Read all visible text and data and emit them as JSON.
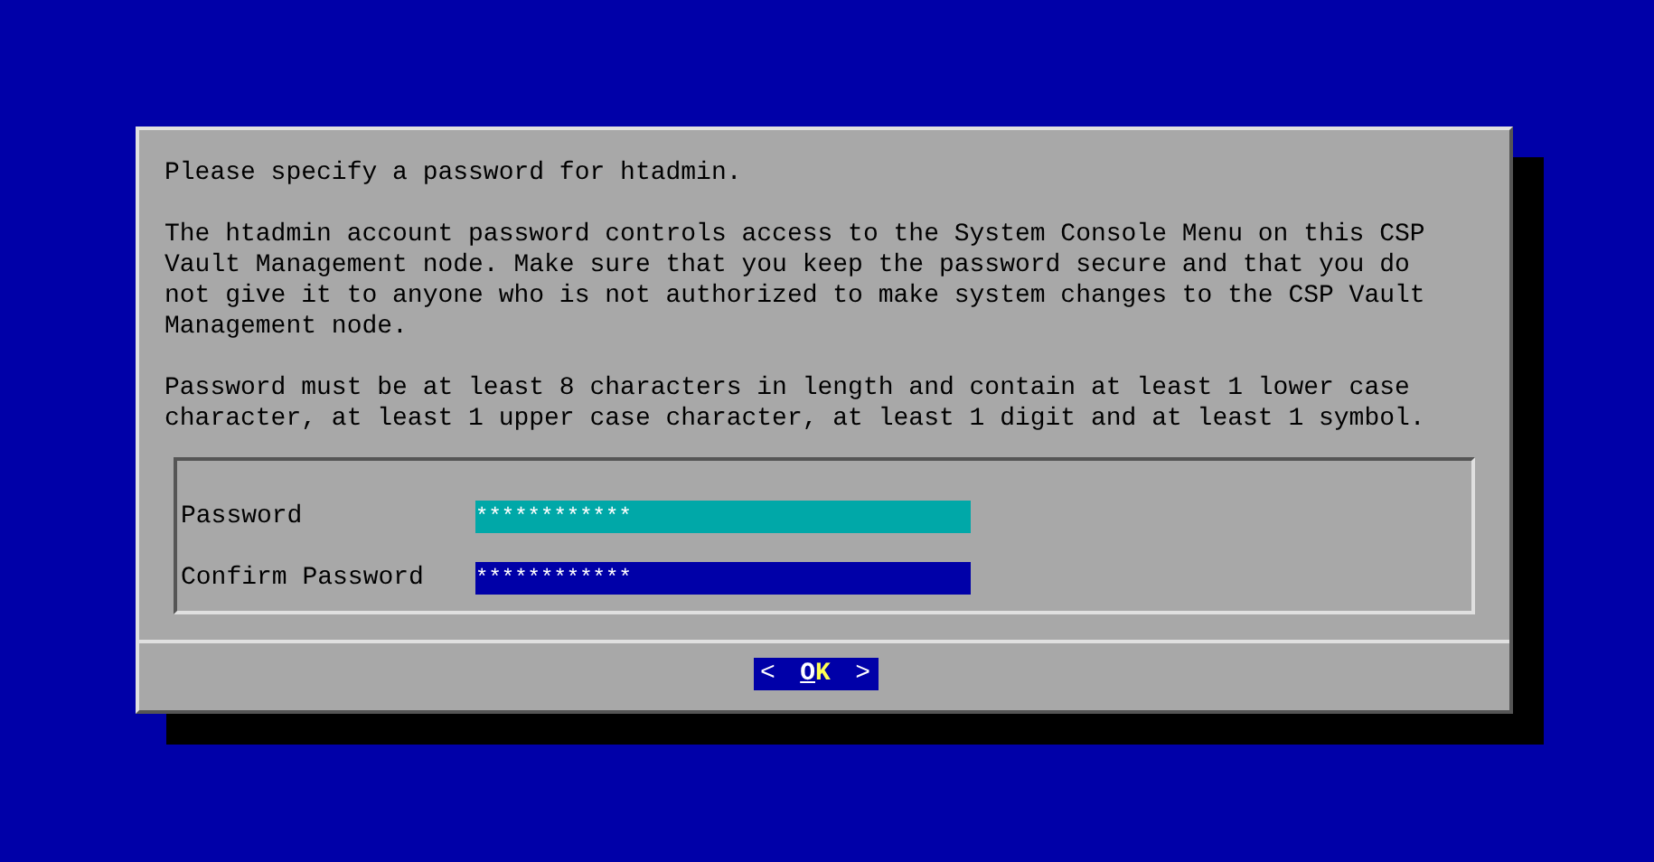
{
  "dialog": {
    "paragraphs": [
      "Please specify a password for htadmin.",
      "The htadmin account password controls access to the System Console Menu on this CSP Vault Management node. Make sure that you keep the password secure and that you do not give it to anyone who is not authorized to make system changes to the CSP Vault Management node.",
      "Password must be at least 8 characters in length and contain at least 1 lower case character, at least 1 upper case character, at least 1 digit and at least 1 symbol."
    ],
    "fields": [
      {
        "label": "Password",
        "value": "************",
        "focused": false
      },
      {
        "label": "Confirm Password",
        "value": "************",
        "focused": true
      }
    ],
    "button": {
      "left": "<",
      "label": "OK",
      "right": ">",
      "focused": true
    }
  }
}
